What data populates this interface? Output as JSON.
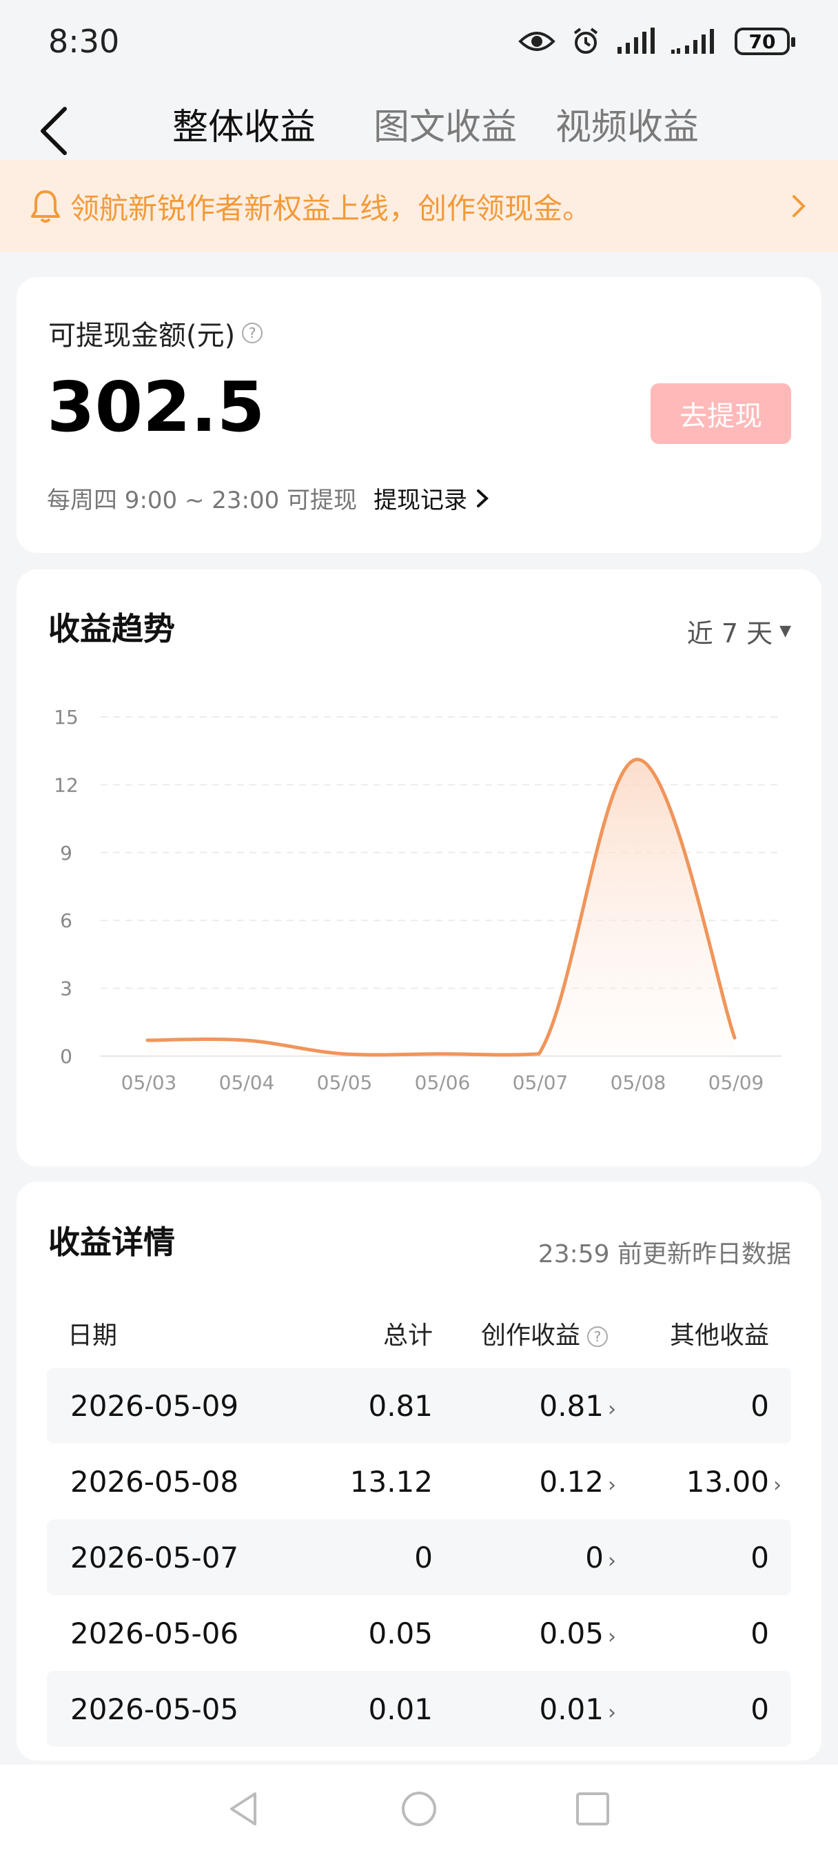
{
  "status_bar": {
    "time": "8:30",
    "battery": "70"
  },
  "nav": {
    "tabs": [
      {
        "label": "整体收益",
        "active": true
      },
      {
        "label": "图文收益",
        "active": false
      },
      {
        "label": "视频收益",
        "active": false
      }
    ]
  },
  "notice": {
    "text": "领航新锐作者新权益上线，创作领现金。"
  },
  "balance": {
    "label": "可提现金额(元)",
    "value": "302.5",
    "withdraw_label": "去提现",
    "schedule": "每周四 9:00 ~ 23:00 可提现",
    "record_label": "提现记录"
  },
  "trend": {
    "title": "收益趋势",
    "range": "近 7 天"
  },
  "chart_data": {
    "type": "area",
    "x": [
      "05/03",
      "05/04",
      "05/05",
      "05/06",
      "05/07",
      "05/08",
      "05/09"
    ],
    "values": [
      0.7,
      0.7,
      0.1,
      0.1,
      0.1,
      13.12,
      0.81
    ],
    "yticks": [
      0,
      3,
      6,
      9,
      12,
      15
    ],
    "ylim": [
      0,
      15
    ],
    "grid": true,
    "color": "#f0955a"
  },
  "detail": {
    "title": "收益详情",
    "note": "23:59 前更新昨日数据",
    "headers": [
      "日期",
      "总计",
      "创作收益",
      "其他收益"
    ],
    "rows": [
      {
        "date": "2026-05-09",
        "total": "0.81",
        "creation": "0.81",
        "other": "0"
      },
      {
        "date": "2026-05-08",
        "total": "13.12",
        "creation": "0.12",
        "other": "13.00"
      },
      {
        "date": "2026-05-07",
        "total": "0",
        "creation": "0",
        "other": "0"
      },
      {
        "date": "2026-05-06",
        "total": "0.05",
        "creation": "0.05",
        "other": "0"
      },
      {
        "date": "2026-05-05",
        "total": "0.01",
        "creation": "0.01",
        "other": "0"
      }
    ]
  },
  "colors": {
    "accent": "#f39a3a",
    "notice_bg": "#fdeee1",
    "withdraw_bg": "#ffb9b9",
    "line": "#f0955a"
  },
  "icons": [
    "eye-icon",
    "alarm-icon",
    "signal-icon",
    "bell-icon",
    "chevron-right-icon",
    "back-icon",
    "help-icon",
    "caret-down-icon"
  ]
}
